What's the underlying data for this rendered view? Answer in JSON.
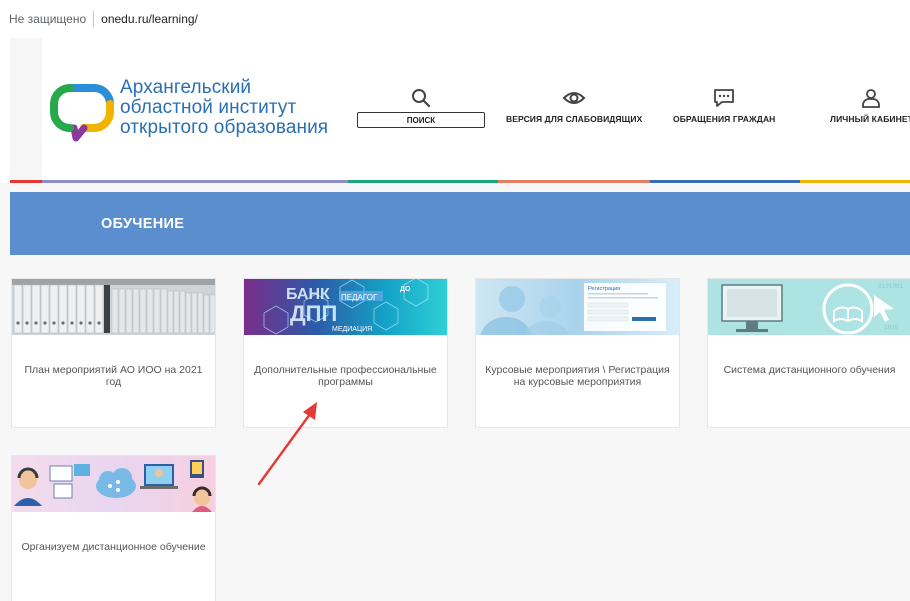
{
  "browser": {
    "security_label": "Не защищено",
    "url": "onedu.ru/learning/"
  },
  "header": {
    "logo_lines": [
      "Архангельский",
      "областной институт",
      "открытого образования"
    ],
    "nav": {
      "search": "ПОИСК",
      "accessibility": "ВЕРСИЯ ДЛЯ СЛАБОВИДЯЩИХ",
      "appeals": "ОБРАЩЕНИЯ ГРАЖДАН",
      "account": "ЛИЧНЫЙ КАБИНЕТ"
    },
    "icons": {
      "search": "search-icon",
      "accessibility": "eye-icon",
      "appeals": "chat-icon",
      "account": "user-icon"
    }
  },
  "stripe_colors": [
    "#e53935",
    "#8e8ec8",
    "#8e8ec8",
    "#1aa67b",
    "#e08060",
    "#3c6bb5",
    "#f0b400"
  ],
  "section": {
    "title": "ОБУЧЕНИЕ",
    "banner_color": "#5b8ece"
  },
  "cards": [
    {
      "title": "План мероприятий АО ИОО на 2021 год"
    },
    {
      "title": "Дополнительные профессиональные программы",
      "thumb_words": [
        "БАНК",
        "ДПП",
        "ПЕДАГОГ",
        "МЕДИАЦИЯ",
        "ДО"
      ]
    },
    {
      "title": "Курсовые мероприятия \\ Регистрация на курсовые мероприятия",
      "thumb_words": [
        "Регистрация"
      ]
    },
    {
      "title": "Система дистанционного обучения"
    },
    {
      "title": "Организуем дистанционное обучение"
    }
  ],
  "annotation": {
    "arrow_color": "#e53935"
  }
}
